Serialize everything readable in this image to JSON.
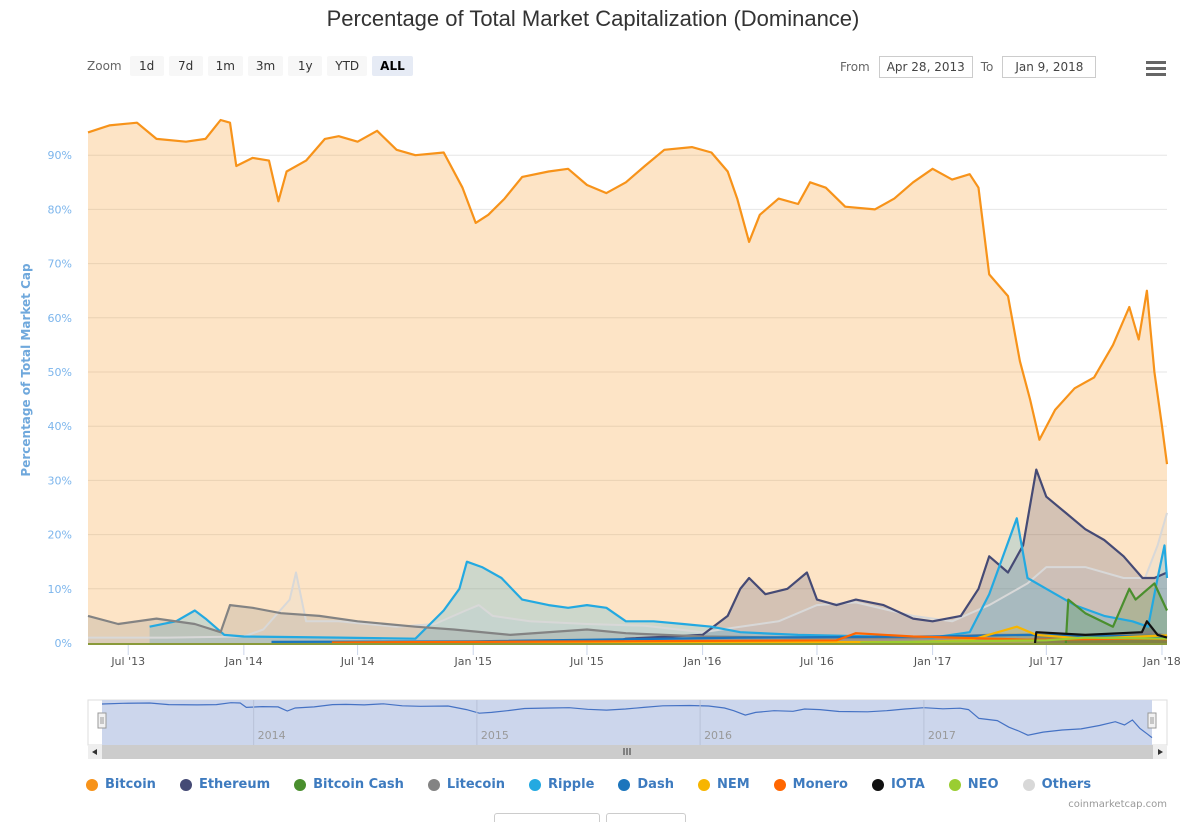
{
  "title": "Percentage of Total Market Capitalization (Dominance)",
  "toolbar": {
    "zoom_label": "Zoom",
    "zoom_buttons": [
      "1d",
      "7d",
      "1m",
      "3m",
      "1y",
      "YTD",
      "ALL"
    ],
    "active_zoom": "ALL",
    "from_label": "From",
    "from_value": "Apr 28, 2013",
    "to_label": "To",
    "to_value": "Jan 9, 2018",
    "menu_icon": "hamburger-menu-icon"
  },
  "credit": "coinmarketcap.com",
  "navigator": {
    "year_labels": [
      "2014",
      "2015",
      "2016",
      "2017"
    ],
    "scroll_left_icon": "arrow-left-icon",
    "scroll_right_icon": "arrow-right-icon",
    "grip_icon": "grip-icon"
  },
  "chart_data": {
    "type": "area",
    "title": "Percentage of Total Market Capitalization (Dominance)",
    "xlabel": "",
    "ylabel": "Percentage of Total Market Cap",
    "x_range": [
      "2013-04-28",
      "2018-01-09"
    ],
    "ylim": [
      0,
      100
    ],
    "y_ticks": [
      "0%",
      "10%",
      "20%",
      "30%",
      "40%",
      "50%",
      "60%",
      "70%",
      "80%",
      "90%"
    ],
    "x_ticks": [
      {
        "date": "2013-07-01",
        "label": "Jul '13"
      },
      {
        "date": "2014-01-01",
        "label": "Jan '14"
      },
      {
        "date": "2014-07-01",
        "label": "Jul '14"
      },
      {
        "date": "2015-01-01",
        "label": "Jan '15"
      },
      {
        "date": "2015-07-01",
        "label": "Jul '15"
      },
      {
        "date": "2016-01-01",
        "label": "Jan '16"
      },
      {
        "date": "2016-07-01",
        "label": "Jul '16"
      },
      {
        "date": "2017-01-01",
        "label": "Jan '17"
      },
      {
        "date": "2017-07-01",
        "label": "Jul '17"
      },
      {
        "date": "2018-01-01",
        "label": "Jan '18"
      }
    ],
    "grid": true,
    "legend_position": "bottom",
    "series": [
      {
        "name": "Bitcoin",
        "color": "#f7931a",
        "points": [
          [
            "2013-04-28",
            94.2
          ],
          [
            "2013-06-01",
            95.5
          ],
          [
            "2013-07-15",
            96
          ],
          [
            "2013-08-15",
            93
          ],
          [
            "2013-10-01",
            92.5
          ],
          [
            "2013-11-01",
            93
          ],
          [
            "2013-11-25",
            96.5
          ],
          [
            "2013-12-10",
            96
          ],
          [
            "2013-12-20",
            88
          ],
          [
            "2014-01-15",
            89.5
          ],
          [
            "2014-02-10",
            89
          ],
          [
            "2014-02-25",
            81.5
          ],
          [
            "2014-03-10",
            87
          ],
          [
            "2014-04-10",
            89
          ],
          [
            "2014-05-10",
            93
          ],
          [
            "2014-06-01",
            93.5
          ],
          [
            "2014-07-01",
            92.5
          ],
          [
            "2014-08-01",
            94.5
          ],
          [
            "2014-09-01",
            91
          ],
          [
            "2014-10-01",
            90
          ],
          [
            "2014-11-15",
            90.5
          ],
          [
            "2014-12-15",
            84
          ],
          [
            "2015-01-05",
            77.5
          ],
          [
            "2015-01-25",
            79
          ],
          [
            "2015-02-20",
            82
          ],
          [
            "2015-03-20",
            86
          ],
          [
            "2015-05-01",
            87
          ],
          [
            "2015-06-01",
            87.5
          ],
          [
            "2015-07-01",
            84.5
          ],
          [
            "2015-08-01",
            83
          ],
          [
            "2015-09-01",
            85
          ],
          [
            "2015-10-01",
            88
          ],
          [
            "2015-11-01",
            91
          ],
          [
            "2015-12-15",
            91.5
          ],
          [
            "2016-01-15",
            90.5
          ],
          [
            "2016-02-10",
            87
          ],
          [
            "2016-02-25",
            82
          ],
          [
            "2016-03-15",
            74
          ],
          [
            "2016-04-01",
            79
          ],
          [
            "2016-05-01",
            82
          ],
          [
            "2016-06-01",
            81
          ],
          [
            "2016-06-20",
            85
          ],
          [
            "2016-07-15",
            84
          ],
          [
            "2016-08-15",
            80.5
          ],
          [
            "2016-10-01",
            80
          ],
          [
            "2016-11-01",
            82
          ],
          [
            "2016-12-01",
            85
          ],
          [
            "2017-01-01",
            87.5
          ],
          [
            "2017-02-01",
            85.5
          ],
          [
            "2017-03-01",
            86.5
          ],
          [
            "2017-03-15",
            84
          ],
          [
            "2017-04-01",
            68
          ],
          [
            "2017-05-01",
            64
          ],
          [
            "2017-05-20",
            52
          ],
          [
            "2017-06-05",
            45
          ],
          [
            "2017-06-20",
            37.5
          ],
          [
            "2017-07-15",
            43
          ],
          [
            "2017-08-15",
            47
          ],
          [
            "2017-09-15",
            49
          ],
          [
            "2017-10-15",
            55
          ],
          [
            "2017-11-10",
            62
          ],
          [
            "2017-11-25",
            56
          ],
          [
            "2017-12-08",
            65
          ],
          [
            "2017-12-20",
            50
          ],
          [
            "2018-01-01",
            40
          ],
          [
            "2018-01-09",
            33
          ]
        ]
      },
      {
        "name": "Ethereum",
        "color": "#454a75",
        "points": [
          [
            "2015-08-07",
            0
          ],
          [
            "2015-09-01",
            0.8
          ],
          [
            "2016-01-01",
            1.5
          ],
          [
            "2016-02-10",
            5
          ],
          [
            "2016-03-01",
            10
          ],
          [
            "2016-03-15",
            12
          ],
          [
            "2016-04-10",
            9
          ],
          [
            "2016-05-15",
            10
          ],
          [
            "2016-06-15",
            13
          ],
          [
            "2016-07-01",
            8
          ],
          [
            "2016-08-01",
            7
          ],
          [
            "2016-09-01",
            8
          ],
          [
            "2016-10-15",
            7
          ],
          [
            "2016-12-01",
            4.5
          ],
          [
            "2017-01-01",
            4
          ],
          [
            "2017-02-15",
            5
          ],
          [
            "2017-03-15",
            10
          ],
          [
            "2017-04-01",
            16
          ],
          [
            "2017-05-01",
            13
          ],
          [
            "2017-05-25",
            18
          ],
          [
            "2017-06-15",
            32
          ],
          [
            "2017-07-01",
            27
          ],
          [
            "2017-08-01",
            24
          ],
          [
            "2017-09-01",
            21
          ],
          [
            "2017-10-01",
            19
          ],
          [
            "2017-11-01",
            16
          ],
          [
            "2017-12-01",
            12
          ],
          [
            "2017-12-20",
            12
          ],
          [
            "2018-01-09",
            13
          ]
        ]
      },
      {
        "name": "Bitcoin Cash",
        "color": "#4a8f2e",
        "points": [
          [
            "2017-08-01",
            0
          ],
          [
            "2017-08-05",
            8
          ],
          [
            "2017-09-01",
            5.5
          ],
          [
            "2017-10-15",
            3
          ],
          [
            "2017-11-10",
            10
          ],
          [
            "2017-11-20",
            8
          ],
          [
            "2017-12-20",
            11
          ],
          [
            "2018-01-09",
            6
          ]
        ]
      },
      {
        "name": "Litecoin",
        "color": "#838383",
        "points": [
          [
            "2013-04-28",
            5
          ],
          [
            "2013-06-15",
            3.5
          ],
          [
            "2013-08-15",
            4.5
          ],
          [
            "2013-10-15",
            3.5
          ],
          [
            "2013-11-25",
            2
          ],
          [
            "2013-12-10",
            7
          ],
          [
            "2014-01-15",
            6.5
          ],
          [
            "2014-03-01",
            5.5
          ],
          [
            "2014-05-01",
            5
          ],
          [
            "2014-07-01",
            4
          ],
          [
            "2014-10-01",
            3
          ],
          [
            "2014-12-01",
            2.5
          ],
          [
            "2015-03-01",
            1.5
          ],
          [
            "2015-07-01",
            2.5
          ],
          [
            "2015-09-01",
            1.8
          ],
          [
            "2016-01-01",
            1.2
          ],
          [
            "2016-06-01",
            1
          ],
          [
            "2016-12-01",
            1
          ],
          [
            "2017-04-01",
            1.5
          ],
          [
            "2017-07-01",
            1.5
          ],
          [
            "2017-10-01",
            1.5
          ],
          [
            "2017-12-15",
            2
          ],
          [
            "2018-01-09",
            1.3
          ]
        ]
      },
      {
        "name": "Ripple",
        "color": "#23a9e1",
        "points": [
          [
            "2013-08-04",
            3
          ],
          [
            "2013-09-15",
            4
          ],
          [
            "2013-10-15",
            6
          ],
          [
            "2013-11-01",
            4.5
          ],
          [
            "2013-12-01",
            1.5
          ],
          [
            "2014-01-01",
            1.2
          ],
          [
            "2014-06-01",
            1
          ],
          [
            "2014-10-01",
            0.8
          ],
          [
            "2014-11-15",
            6
          ],
          [
            "2014-12-10",
            10
          ],
          [
            "2014-12-22",
            15
          ],
          [
            "2015-01-15",
            14
          ],
          [
            "2015-02-15",
            12
          ],
          [
            "2015-03-20",
            8
          ],
          [
            "2015-05-01",
            7
          ],
          [
            "2015-06-01",
            6.5
          ],
          [
            "2015-07-01",
            7
          ],
          [
            "2015-08-01",
            6.5
          ],
          [
            "2015-09-01",
            4
          ],
          [
            "2015-10-15",
            4
          ],
          [
            "2015-12-01",
            3.5
          ],
          [
            "2016-01-15",
            3
          ],
          [
            "2016-03-01",
            2
          ],
          [
            "2016-06-01",
            1.5
          ],
          [
            "2016-10-01",
            1.2
          ],
          [
            "2017-01-01",
            1
          ],
          [
            "2017-03-01",
            2
          ],
          [
            "2017-04-01",
            9
          ],
          [
            "2017-05-15",
            23
          ],
          [
            "2017-06-01",
            12
          ],
          [
            "2017-07-01",
            10
          ],
          [
            "2017-08-15",
            7
          ],
          [
            "2017-10-01",
            5
          ],
          [
            "2017-11-15",
            4
          ],
          [
            "2017-12-10",
            3
          ],
          [
            "2017-12-25",
            12
          ],
          [
            "2018-01-05",
            18
          ],
          [
            "2018-01-09",
            12
          ]
        ]
      },
      {
        "name": "Dash",
        "color": "#1c75bc",
        "points": [
          [
            "2014-02-14",
            0.2
          ],
          [
            "2015-01-01",
            0.3
          ],
          [
            "2016-03-01",
            1
          ],
          [
            "2017-01-01",
            1.2
          ],
          [
            "2017-06-01",
            1.5
          ],
          [
            "2017-12-01",
            1.2
          ],
          [
            "2018-01-09",
            0.8
          ]
        ]
      },
      {
        "name": "NEM",
        "color": "#f7b500",
        "points": [
          [
            "2015-04-01",
            0.1
          ],
          [
            "2016-12-01",
            0.2
          ],
          [
            "2017-03-01",
            0.5
          ],
          [
            "2017-05-15",
            3
          ],
          [
            "2017-06-15",
            1.5
          ],
          [
            "2017-09-01",
            0.8
          ],
          [
            "2018-01-09",
            1.4
          ]
        ]
      },
      {
        "name": "Monero",
        "color": "#ff6600",
        "points": [
          [
            "2014-05-21",
            0.1
          ],
          [
            "2016-08-01",
            0.5
          ],
          [
            "2016-09-01",
            1.8
          ],
          [
            "2016-12-01",
            1.2
          ],
          [
            "2017-06-01",
            0.6
          ],
          [
            "2017-12-01",
            0.8
          ],
          [
            "2018-01-09",
            0.7
          ]
        ]
      },
      {
        "name": "IOTA",
        "color": "#111111",
        "points": [
          [
            "2017-06-13",
            0
          ],
          [
            "2017-06-15",
            2
          ],
          [
            "2017-09-01",
            1.5
          ],
          [
            "2017-11-30",
            2
          ],
          [
            "2017-12-08",
            4
          ],
          [
            "2017-12-25",
            1.5
          ],
          [
            "2018-01-09",
            1
          ]
        ]
      },
      {
        "name": "NEO",
        "color": "#9acd32",
        "points": [
          [
            "2016-09-08",
            0.1
          ],
          [
            "2017-07-01",
            0.5
          ],
          [
            "2017-09-01",
            1
          ],
          [
            "2018-01-09",
            0.8
          ]
        ]
      },
      {
        "name": "Others",
        "color": "#d8d8d8",
        "points": [
          [
            "2013-04-28",
            1
          ],
          [
            "2013-09-01",
            1
          ],
          [
            "2014-01-01",
            1.2
          ],
          [
            "2014-02-01",
            2.5
          ],
          [
            "2014-03-15",
            8
          ],
          [
            "2014-03-25",
            13
          ],
          [
            "2014-04-10",
            4
          ],
          [
            "2014-06-01",
            4
          ],
          [
            "2014-09-01",
            3
          ],
          [
            "2014-11-01",
            3.5
          ],
          [
            "2014-12-20",
            6
          ],
          [
            "2015-01-10",
            7
          ],
          [
            "2015-02-01",
            5
          ],
          [
            "2015-04-01",
            4
          ],
          [
            "2015-07-01",
            3.5
          ],
          [
            "2015-10-01",
            3.2
          ],
          [
            "2016-01-01",
            2
          ],
          [
            "2016-03-01",
            3
          ],
          [
            "2016-05-01",
            4
          ],
          [
            "2016-07-01",
            7
          ],
          [
            "2016-09-01",
            7.5
          ],
          [
            "2016-12-01",
            5
          ],
          [
            "2017-02-01",
            4
          ],
          [
            "2017-04-01",
            7
          ],
          [
            "2017-06-01",
            11
          ],
          [
            "2017-07-01",
            14
          ],
          [
            "2017-09-01",
            14
          ],
          [
            "2017-11-01",
            12
          ],
          [
            "2017-12-05",
            12
          ],
          [
            "2017-12-25",
            18
          ],
          [
            "2018-01-09",
            24
          ]
        ]
      }
    ]
  }
}
